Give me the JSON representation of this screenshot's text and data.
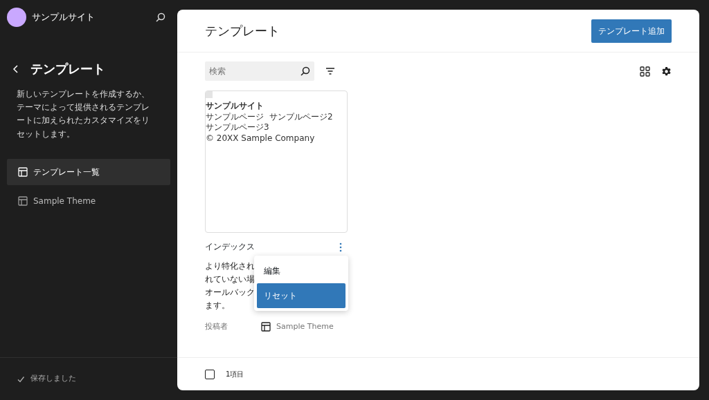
{
  "site": {
    "name": "サンプルサイト"
  },
  "sidebar": {
    "title": "テンプレート",
    "description": "新しいテンプレートを作成するか、テーマによって提供されるテンプレートに加えられたカスタマイズをリセットします。",
    "items": [
      {
        "label": "テンプレート一覧",
        "selected": true
      },
      {
        "label": "Sample Theme",
        "selected": false
      }
    ],
    "status": "保存しました"
  },
  "header": {
    "title": "テンプレート",
    "add_button": "テンプレート追加"
  },
  "search": {
    "placeholder": "検索"
  },
  "templates": [
    {
      "title": "インデックス",
      "preview": {
        "site_title": "サンプルサイト",
        "nav": [
          "サンプルページ",
          "サンプルページ2",
          "サンプルページ3"
        ],
        "footer": "© 20XX Sample Company"
      },
      "description_lines": [
        "より特化され",
        "れていない場",
        "オールバック",
        "ます。"
      ],
      "author_label": "投稿者",
      "author": "Sample Theme"
    }
  ],
  "menu": {
    "items": [
      {
        "label": "編集",
        "selected": false
      },
      {
        "label": "リセット",
        "selected": true
      }
    ]
  },
  "footer": {
    "select_all_checked": false,
    "count": "1項目"
  }
}
